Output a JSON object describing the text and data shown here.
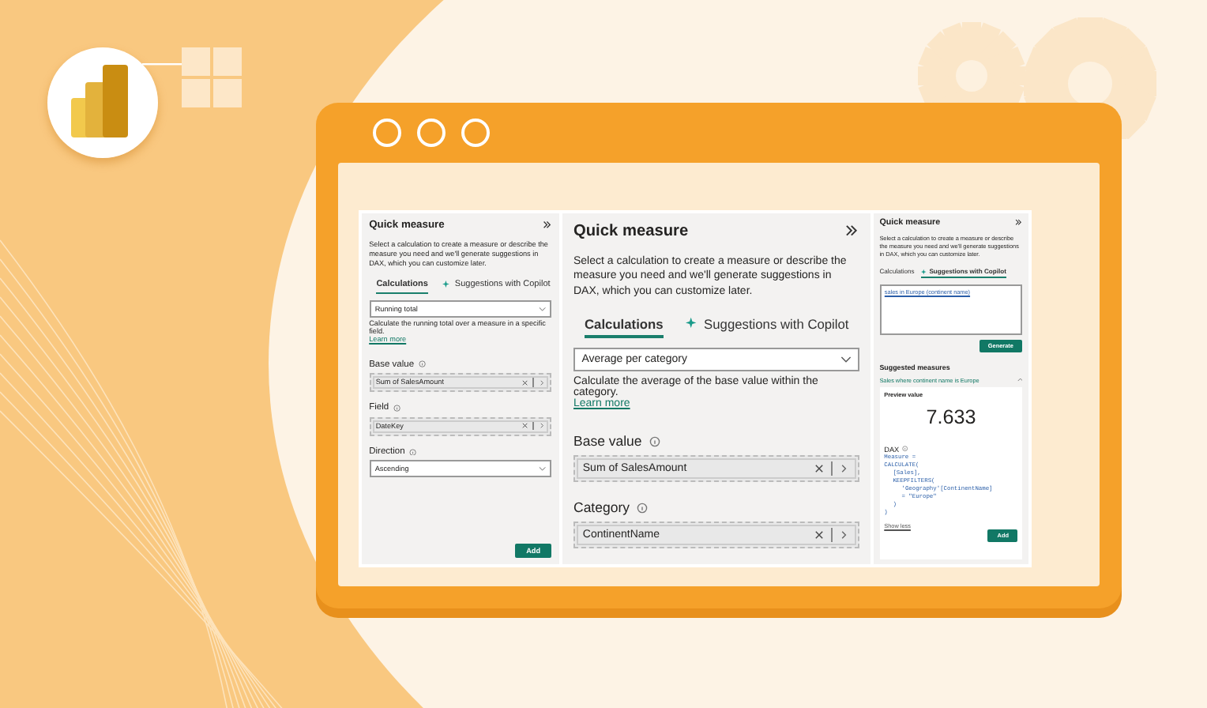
{
  "panels": [
    {
      "kind": "calculations",
      "title": "Quick measure",
      "description": "Select a calculation to create a measure or describe the measure you need and we'll generate suggestions in DAX, which you can customize later.",
      "tabs": [
        {
          "label": "Calculations",
          "selected": true
        },
        {
          "label": "Suggestions with Copilot",
          "selected": false
        }
      ],
      "calculation": "Running total",
      "calc_description": "Calculate the running total over a measure in a specific field.",
      "learn_more": "Learn more",
      "fields": [
        {
          "kind": "well",
          "label": "Base value",
          "value": "Sum of SalesAmount"
        },
        {
          "kind": "well",
          "label": "Field",
          "value": "DateKey"
        },
        {
          "kind": "dropdown",
          "label": "Direction",
          "value": "Ascending"
        }
      ],
      "add_button": "Add"
    },
    {
      "kind": "calculations",
      "title": "Quick measure",
      "description": "Select a calculation to create a measure or describe the measure you need and we'll generate suggestions in DAX, which you can customize later.",
      "tabs": [
        {
          "label": "Calculations",
          "selected": true
        },
        {
          "label": "Suggestions with Copilot",
          "selected": false
        }
      ],
      "calculation": "Average per category",
      "calc_description": "Calculate the average of the base value within the category.",
      "learn_more": "Learn more",
      "fields": [
        {
          "kind": "well",
          "label": "Base value",
          "value": "Sum of SalesAmount"
        },
        {
          "kind": "well",
          "label": "Category",
          "value": "ContinentName"
        }
      ]
    },
    {
      "kind": "copilot",
      "title": "Quick measure",
      "description": "Select a calculation to create a measure or describe the measure you need and we'll generate suggestions in DAX, which you can customize later.",
      "tabs": [
        {
          "label": "Calculations",
          "selected": false
        },
        {
          "label": "Suggestions with Copilot",
          "selected": true
        }
      ],
      "prompt": "sales in Europe (continent name)",
      "generate_button": "Generate",
      "suggested_heading": "Suggested measures",
      "suggestion": "Sales where continent name is Europe",
      "preview_label": "Preview value",
      "preview_value": "7.633",
      "dax_label": "DAX",
      "dax_lines": [
        "Measure =",
        "CALCULATE(",
        "[Sales],",
        "KEEPFILTERS(",
        "'Geography'[ContinentName]",
        "= \"Europe\"",
        ")",
        ")"
      ],
      "show_less": "Show less",
      "add_button": "Add"
    }
  ]
}
